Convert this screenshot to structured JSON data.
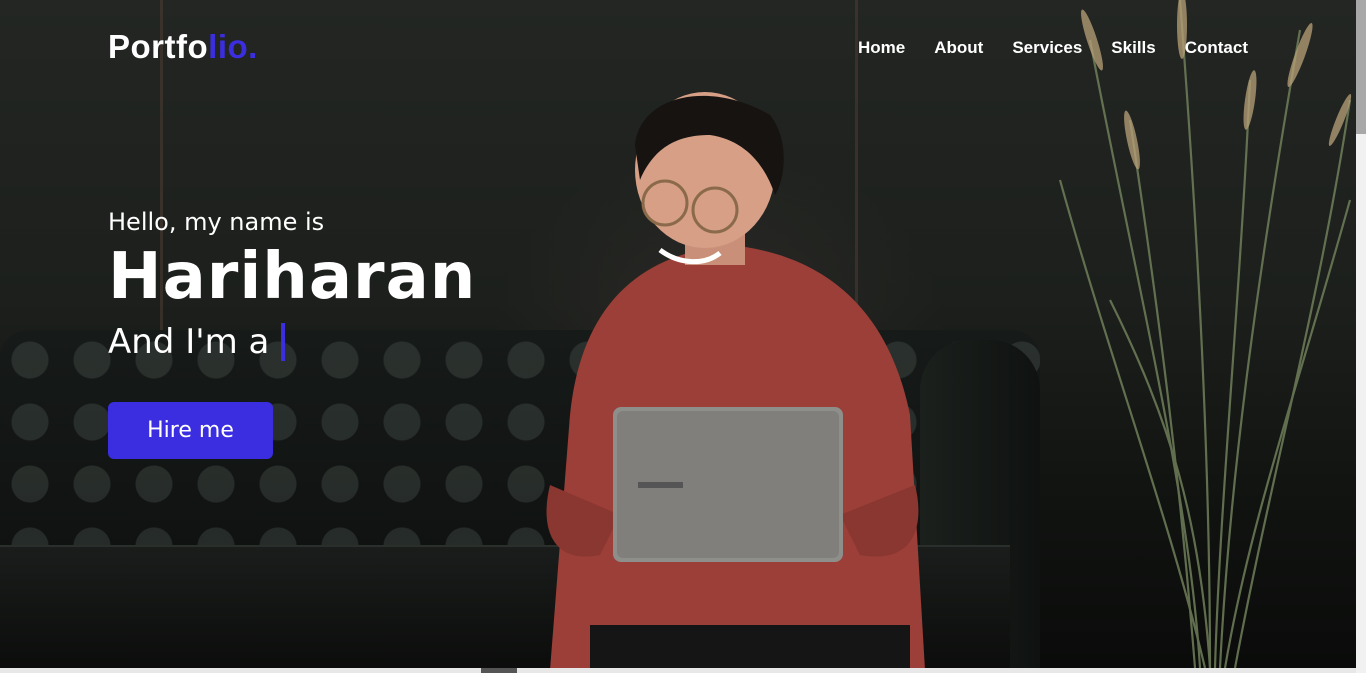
{
  "logo": {
    "main": "Portfo",
    "accent": "lio."
  },
  "nav": {
    "home": "Home",
    "about": "About",
    "services": "Services",
    "skills": "Skills",
    "contact": "Contact"
  },
  "hero": {
    "greeting": "Hello, my name is",
    "name": "Hariharan",
    "role_prefix": "And I'm a",
    "button": "Hire me"
  },
  "colors": {
    "accent": "#3b2ee0",
    "text": "#ffffff",
    "background": "#1c1f1c"
  },
  "icons": {
    "typing_cursor": "text-cursor-icon"
  },
  "page_scroll": {
    "position": 0
  }
}
